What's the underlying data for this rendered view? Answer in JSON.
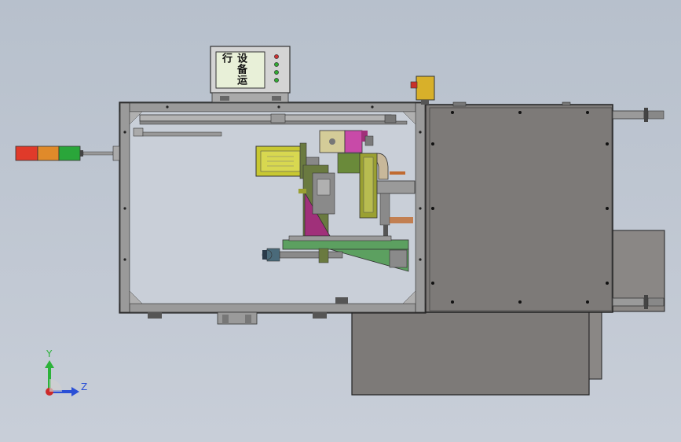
{
  "viewport": {
    "background_top": "#b7c0cc",
    "background_bottom": "#c8ced8"
  },
  "hmi": {
    "screen_text": "设备运行",
    "indicator_colors": [
      "#cc3333",
      "#33aa33",
      "#33aa33",
      "#33aa33"
    ]
  },
  "signal_tower": {
    "colors": [
      "#e03a2a",
      "#e08a2a",
      "#2aa63a"
    ]
  },
  "emergency_stop": {
    "color": "#d8b02a"
  },
  "triad": {
    "y_label": "Y",
    "z_label": "Z",
    "y_color": "#2cb23a",
    "z_color": "#2a4fd6",
    "origin_color": "#cc2a2a"
  },
  "colors": {
    "frame": "#8c8c8c",
    "frame_dark": "#555555",
    "panel_gray": "#7d7a78",
    "motor_yellow": "#c8c832",
    "bracket_magenta": "#a0307a",
    "plate_green": "#5ca060",
    "slide_olive": "#9aa032",
    "pink": "#d86ab0"
  }
}
